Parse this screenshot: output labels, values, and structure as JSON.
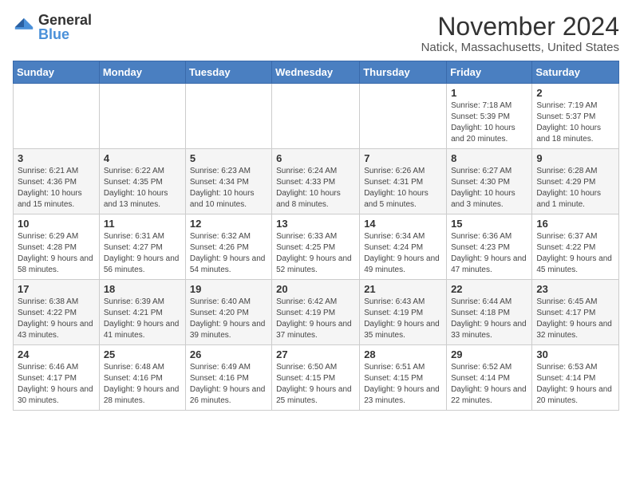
{
  "logo": {
    "text_general": "General",
    "text_blue": "Blue"
  },
  "header": {
    "month_title": "November 2024",
    "location": "Natick, Massachusetts, United States"
  },
  "weekdays": [
    "Sunday",
    "Monday",
    "Tuesday",
    "Wednesday",
    "Thursday",
    "Friday",
    "Saturday"
  ],
  "weeks": [
    [
      {
        "day": "",
        "info": ""
      },
      {
        "day": "",
        "info": ""
      },
      {
        "day": "",
        "info": ""
      },
      {
        "day": "",
        "info": ""
      },
      {
        "day": "",
        "info": ""
      },
      {
        "day": "1",
        "info": "Sunrise: 7:18 AM\nSunset: 5:39 PM\nDaylight: 10 hours and 20 minutes."
      },
      {
        "day": "2",
        "info": "Sunrise: 7:19 AM\nSunset: 5:37 PM\nDaylight: 10 hours and 18 minutes."
      }
    ],
    [
      {
        "day": "3",
        "info": "Sunrise: 6:21 AM\nSunset: 4:36 PM\nDaylight: 10 hours and 15 minutes."
      },
      {
        "day": "4",
        "info": "Sunrise: 6:22 AM\nSunset: 4:35 PM\nDaylight: 10 hours and 13 minutes."
      },
      {
        "day": "5",
        "info": "Sunrise: 6:23 AM\nSunset: 4:34 PM\nDaylight: 10 hours and 10 minutes."
      },
      {
        "day": "6",
        "info": "Sunrise: 6:24 AM\nSunset: 4:33 PM\nDaylight: 10 hours and 8 minutes."
      },
      {
        "day": "7",
        "info": "Sunrise: 6:26 AM\nSunset: 4:31 PM\nDaylight: 10 hours and 5 minutes."
      },
      {
        "day": "8",
        "info": "Sunrise: 6:27 AM\nSunset: 4:30 PM\nDaylight: 10 hours and 3 minutes."
      },
      {
        "day": "9",
        "info": "Sunrise: 6:28 AM\nSunset: 4:29 PM\nDaylight: 10 hours and 1 minute."
      }
    ],
    [
      {
        "day": "10",
        "info": "Sunrise: 6:29 AM\nSunset: 4:28 PM\nDaylight: 9 hours and 58 minutes."
      },
      {
        "day": "11",
        "info": "Sunrise: 6:31 AM\nSunset: 4:27 PM\nDaylight: 9 hours and 56 minutes."
      },
      {
        "day": "12",
        "info": "Sunrise: 6:32 AM\nSunset: 4:26 PM\nDaylight: 9 hours and 54 minutes."
      },
      {
        "day": "13",
        "info": "Sunrise: 6:33 AM\nSunset: 4:25 PM\nDaylight: 9 hours and 52 minutes."
      },
      {
        "day": "14",
        "info": "Sunrise: 6:34 AM\nSunset: 4:24 PM\nDaylight: 9 hours and 49 minutes."
      },
      {
        "day": "15",
        "info": "Sunrise: 6:36 AM\nSunset: 4:23 PM\nDaylight: 9 hours and 47 minutes."
      },
      {
        "day": "16",
        "info": "Sunrise: 6:37 AM\nSunset: 4:22 PM\nDaylight: 9 hours and 45 minutes."
      }
    ],
    [
      {
        "day": "17",
        "info": "Sunrise: 6:38 AM\nSunset: 4:22 PM\nDaylight: 9 hours and 43 minutes."
      },
      {
        "day": "18",
        "info": "Sunrise: 6:39 AM\nSunset: 4:21 PM\nDaylight: 9 hours and 41 minutes."
      },
      {
        "day": "19",
        "info": "Sunrise: 6:40 AM\nSunset: 4:20 PM\nDaylight: 9 hours and 39 minutes."
      },
      {
        "day": "20",
        "info": "Sunrise: 6:42 AM\nSunset: 4:19 PM\nDaylight: 9 hours and 37 minutes."
      },
      {
        "day": "21",
        "info": "Sunrise: 6:43 AM\nSunset: 4:19 PM\nDaylight: 9 hours and 35 minutes."
      },
      {
        "day": "22",
        "info": "Sunrise: 6:44 AM\nSunset: 4:18 PM\nDaylight: 9 hours and 33 minutes."
      },
      {
        "day": "23",
        "info": "Sunrise: 6:45 AM\nSunset: 4:17 PM\nDaylight: 9 hours and 32 minutes."
      }
    ],
    [
      {
        "day": "24",
        "info": "Sunrise: 6:46 AM\nSunset: 4:17 PM\nDaylight: 9 hours and 30 minutes."
      },
      {
        "day": "25",
        "info": "Sunrise: 6:48 AM\nSunset: 4:16 PM\nDaylight: 9 hours and 28 minutes."
      },
      {
        "day": "26",
        "info": "Sunrise: 6:49 AM\nSunset: 4:16 PM\nDaylight: 9 hours and 26 minutes."
      },
      {
        "day": "27",
        "info": "Sunrise: 6:50 AM\nSunset: 4:15 PM\nDaylight: 9 hours and 25 minutes."
      },
      {
        "day": "28",
        "info": "Sunrise: 6:51 AM\nSunset: 4:15 PM\nDaylight: 9 hours and 23 minutes."
      },
      {
        "day": "29",
        "info": "Sunrise: 6:52 AM\nSunset: 4:14 PM\nDaylight: 9 hours and 22 minutes."
      },
      {
        "day": "30",
        "info": "Sunrise: 6:53 AM\nSunset: 4:14 PM\nDaylight: 9 hours and 20 minutes."
      }
    ]
  ]
}
